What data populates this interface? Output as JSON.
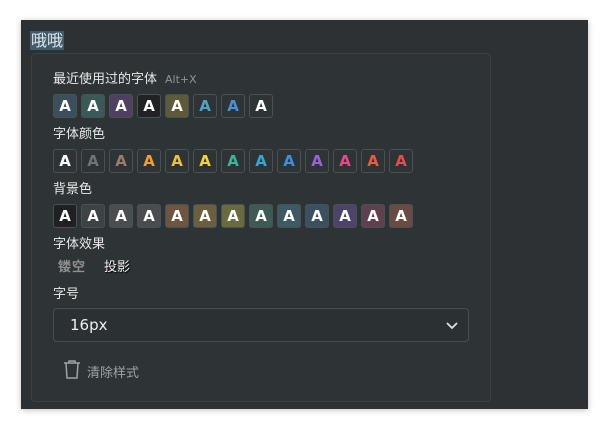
{
  "editor": {
    "text": "哦哦"
  },
  "panel": {
    "recent": {
      "title": "最近使用过的字体",
      "shortcut": "Alt+X",
      "swatches": [
        {
          "letter": "A",
          "color": "#ffffff",
          "bg": "#3a4f5a"
        },
        {
          "letter": "A",
          "color": "#ffffff",
          "bg": "#3a5a5a"
        },
        {
          "letter": "A",
          "color": "#ffffff",
          "bg": "#4e3f63"
        },
        {
          "letter": "A",
          "color": "#ffffff",
          "bg": "#202224"
        },
        {
          "letter": "A",
          "color": "#ffffff",
          "bg": "#5d5a3a"
        },
        {
          "letter": "A",
          "color": "#4fa3c7",
          "bg": "#2e3336"
        },
        {
          "letter": "A",
          "color": "#4a90d9",
          "bg": "#2e3336"
        },
        {
          "letter": "A",
          "color": "#ffffff",
          "bg": "#2e3336"
        }
      ]
    },
    "font_color": {
      "title": "字体颜色",
      "swatches": [
        {
          "letter": "A",
          "color": "#ffffff",
          "bg": "#2e3336"
        },
        {
          "letter": "A",
          "color": "#6f7377",
          "bg": "#2e3336"
        },
        {
          "letter": "A",
          "color": "#9a7b6c",
          "bg": "#2e3336"
        },
        {
          "letter": "A",
          "color": "#f0a033",
          "bg": "#2e3336"
        },
        {
          "letter": "A",
          "color": "#f2c037",
          "bg": "#2e3336"
        },
        {
          "letter": "A",
          "color": "#f5d33a",
          "bg": "#2e3336"
        },
        {
          "letter": "A",
          "color": "#3fb39a",
          "bg": "#2e3336"
        },
        {
          "letter": "A",
          "color": "#3aa3d6",
          "bg": "#2e3336"
        },
        {
          "letter": "A",
          "color": "#3e8fe0",
          "bg": "#2e3336"
        },
        {
          "letter": "A",
          "color": "#9b62d6",
          "bg": "#2e3336"
        },
        {
          "letter": "A",
          "color": "#e14b8a",
          "bg": "#2e3336"
        },
        {
          "letter": "A",
          "color": "#eb5a45",
          "bg": "#2e3336"
        },
        {
          "letter": "A",
          "color": "#e84b4b",
          "bg": "#2e3336"
        }
      ]
    },
    "background_color": {
      "title": "背景色",
      "swatches": [
        {
          "letter": "A",
          "color": "#ffffff",
          "bg": "#1e2022"
        },
        {
          "letter": "A",
          "color": "#ffffff",
          "bg": "#3d4245"
        },
        {
          "letter": "A",
          "color": "#ffffff",
          "bg": "#4a4e50"
        },
        {
          "letter": "A",
          "color": "#ffffff",
          "bg": "#4a4d4f"
        },
        {
          "letter": "A",
          "color": "#ffffff",
          "bg": "#6e5540"
        },
        {
          "letter": "A",
          "color": "#ffffff",
          "bg": "#6b5f3f"
        },
        {
          "letter": "A",
          "color": "#ffffff",
          "bg": "#6a6a40"
        },
        {
          "letter": "A",
          "color": "#ffffff",
          "bg": "#3e5a54"
        },
        {
          "letter": "A",
          "color": "#ffffff",
          "bg": "#3d5961"
        },
        {
          "letter": "A",
          "color": "#ffffff",
          "bg": "#3c5160"
        },
        {
          "letter": "A",
          "color": "#ffffff",
          "bg": "#4e4369"
        },
        {
          "letter": "A",
          "color": "#ffffff",
          "bg": "#60404f"
        },
        {
          "letter": "A",
          "color": "#ffffff",
          "bg": "#6a4a45"
        }
      ]
    },
    "font_effect": {
      "title": "字体效果",
      "hollow": "镂空",
      "shadow": "投影"
    },
    "font_size": {
      "title": "字号",
      "value": "16px"
    },
    "clear_label": "清除样式"
  }
}
